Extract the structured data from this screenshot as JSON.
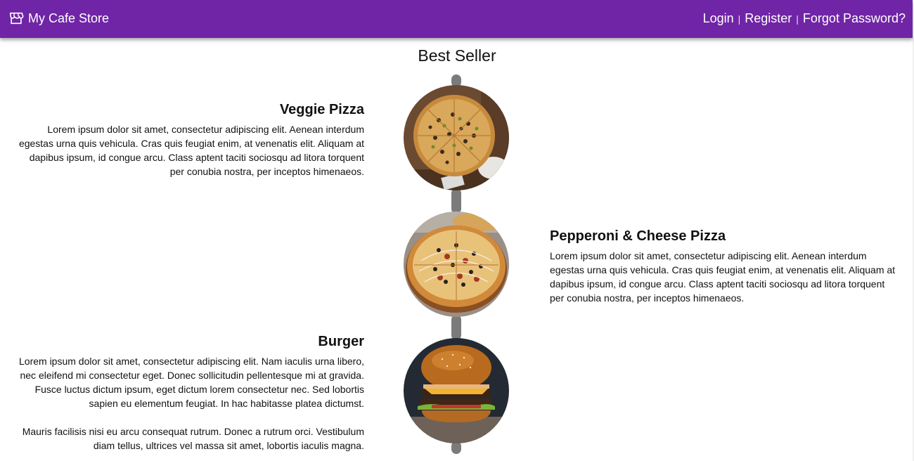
{
  "header": {
    "brand": "My Cafe Store",
    "brand_icon": "store-icon",
    "nav": {
      "login": "Login",
      "register": "Register",
      "forgot_password": "Forgot Password?",
      "separator": "|"
    },
    "color": "#7025a6"
  },
  "main": {
    "title": "Best Seller",
    "items": [
      {
        "name": "Veggie Pizza",
        "paragraphs": [
          "Lorem ipsum dolor sit amet, consectetur adipiscing elit. Aenean interdum egestas urna quis vehicula. Cras quis feugiat enim, at venenatis elit. Aliquam at dapibus ipsum, id congue arcu. Class aptent taciti sociosqu ad litora torquent per conubia nostra, per inceptos himenaeos."
        ]
      },
      {
        "name": "Pepperoni & Cheese Pizza",
        "paragraphs": [
          "Lorem ipsum dolor sit amet, consectetur adipiscing elit. Aenean interdum egestas urna quis vehicula. Cras quis feugiat enim, at venenatis elit. Aliquam at dapibus ipsum, id congue arcu. Class aptent taciti sociosqu ad litora torquent per conubia nostra, per inceptos himenaeos."
        ]
      },
      {
        "name": "Burger",
        "paragraphs": [
          "Lorem ipsum dolor sit amet, consectetur adipiscing elit. Nam iaculis urna libero, nec eleifend mi consectetur eget. Donec sollicitudin pellentesque mi at gravida. Fusce luctus dictum ipsum, eget dictum lorem consectetur nec. Sed lobortis sapien eu elementum feugiat. In hac habitasse platea dictumst.",
          "Mauris facilisis nisi eu arcu consequat rutrum. Donec a rutrum orci. Vestibulum diam tellus, ultrices vel massa sit amet, lobortis iaculis magna."
        ]
      }
    ]
  }
}
